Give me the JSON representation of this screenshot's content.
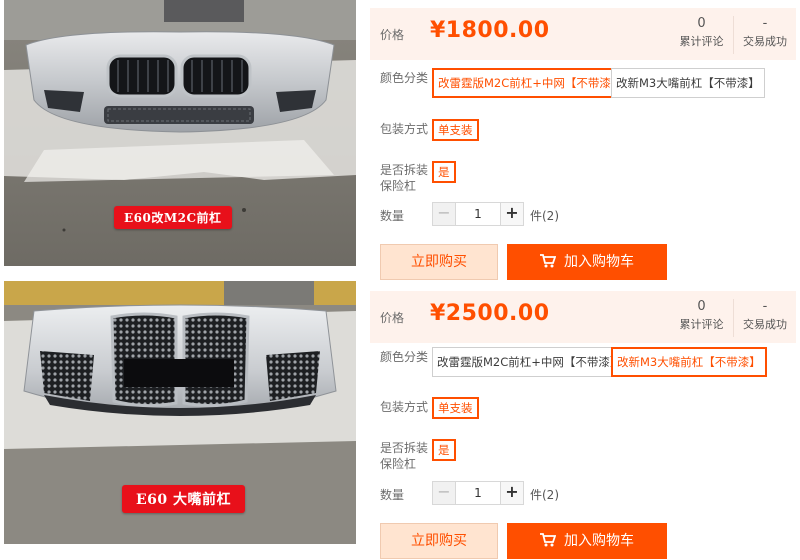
{
  "photos": [
    {
      "caption": "E60改M2C前杠"
    },
    {
      "caption": "E60 大嘴前杠"
    }
  ],
  "listings": [
    {
      "price_label": "价格",
      "price": "¥1800.00",
      "reviews": {
        "value": "0",
        "label": "累计评论"
      },
      "sales": {
        "value": "-",
        "label": "交易成功"
      },
      "color_label": "颜色分类",
      "color_options": [
        {
          "name": "改雷霆版M2C前杠+中网",
          "tag": "【不带漆】",
          "selected": true
        },
        {
          "name": "改新M3大嘴前杠",
          "tag": "【不带漆】",
          "selected": false
        }
      ],
      "package_label": "包装方式",
      "package_option": "单支装",
      "disassemble_label_1": "是否拆装",
      "disassemble_label_2": "保险杠",
      "disassemble_option": "是",
      "quantity_label": "数量",
      "quantity_minus": "−",
      "quantity_value": "1",
      "quantity_plus": "+",
      "quantity_unit": "件(2)",
      "buy_now": "立即购买",
      "add_cart": "加入购物车"
    },
    {
      "price_label": "价格",
      "price": "¥2500.00",
      "reviews": {
        "value": "0",
        "label": "累计评论"
      },
      "sales": {
        "value": "-",
        "label": "交易成功"
      },
      "color_label": "颜色分类",
      "color_options": [
        {
          "name": "改雷霆版M2C前杠+中网",
          "tag": "【不带漆】",
          "selected": false
        },
        {
          "name": "改新M3大嘴前杠",
          "tag": "【不带漆】",
          "selected": true
        }
      ],
      "package_label": "包装方式",
      "package_option": "单支装",
      "disassemble_label_1": "是否拆装",
      "disassemble_label_2": "保险杠",
      "disassemble_option": "是",
      "quantity_label": "数量",
      "quantity_minus": "−",
      "quantity_value": "1",
      "quantity_plus": "+",
      "quantity_unit": "件(2)",
      "buy_now": "立即购买",
      "add_cart": "加入购物车"
    }
  ],
  "colors": {
    "accent": "#ff4f00",
    "accent_light": "#ffe4d0",
    "price_bar": "#fef2ec",
    "caption_red": "#e8101a"
  }
}
